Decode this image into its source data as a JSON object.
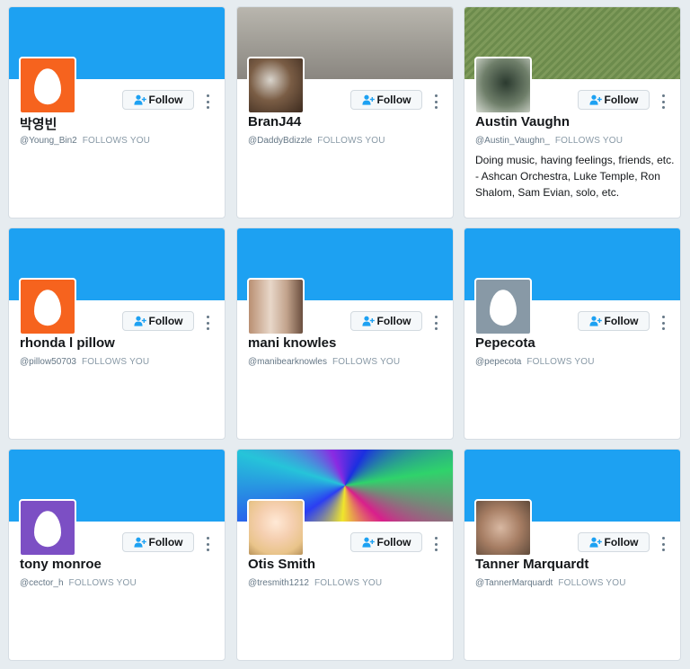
{
  "follow_label": "Follow",
  "follows_you_label": "FOLLOWS YOU",
  "colors": {
    "banner_default": "#1da1f2",
    "follow_icon": "#1da1f2"
  },
  "profiles": [
    {
      "name": "박영빈",
      "handle": "@Young_Bin2",
      "bio": "",
      "avatar": "default-egg",
      "avatar_color": "#f6631e",
      "banner": "default"
    },
    {
      "name": "BranJ44",
      "handle": "@DaddyBdizzle",
      "bio": "",
      "avatar": "photo",
      "banner": "photo"
    },
    {
      "name": "Austin Vaughn",
      "handle": "@Austin_Vaughn_",
      "bio": "Doing music, having feelings, friends, etc. - Ashcan Orchestra, Luke Temple, Ron Shalom, Sam Evian, solo, etc.",
      "avatar": "photo",
      "banner": "photo"
    },
    {
      "name": "rhonda l pillow",
      "handle": "@pillow50703",
      "bio": "",
      "avatar": "default-egg",
      "avatar_color": "#f6631e",
      "banner": "default"
    },
    {
      "name": "mani knowles",
      "handle": "@manibearknowles",
      "bio": "",
      "avatar": "photo",
      "banner": "default"
    },
    {
      "name": "Pepecota",
      "handle": "@pepecota",
      "bio": "",
      "avatar": "default-egg",
      "avatar_color": "#8899a6",
      "banner": "default"
    },
    {
      "name": "tony monroe",
      "handle": "@cector_h",
      "bio": "",
      "avatar": "default-egg",
      "avatar_color": "#7c4fc4",
      "banner": "default"
    },
    {
      "name": "Otis Smith",
      "handle": "@tresmith1212",
      "bio": "",
      "avatar": "photo",
      "banner": "photo"
    },
    {
      "name": "Tanner Marquardt",
      "handle": "@TannerMarquardt",
      "bio": "",
      "avatar": "photo",
      "banner": "default"
    }
  ]
}
